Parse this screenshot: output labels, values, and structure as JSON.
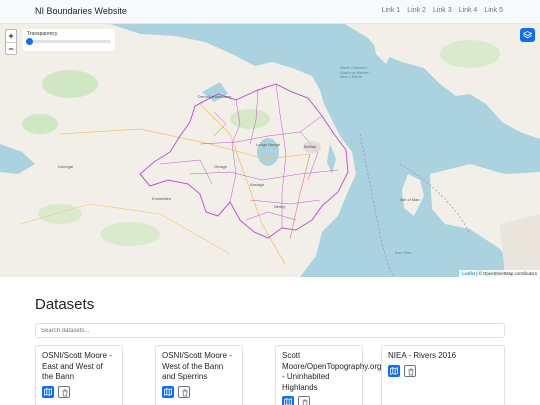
{
  "navbar": {
    "brand": "NI Boundaries Website",
    "links": [
      "Link 1",
      "Link 2",
      "Link 3",
      "Link 4",
      "Link 5"
    ]
  },
  "map": {
    "zoom_in": "+",
    "zoom_out": "−",
    "transparency_label": "Transparency",
    "transparency_value": 0,
    "attribution_leaflet": "Leaflet",
    "attribution_rest": " | © OpenStreetMap contributors",
    "labels": {
      "north_channel": "North Channel / Sruth na Maoile / Sea o Movle",
      "belfast": "Belfast",
      "armagh": "Armagh",
      "isle_of_man": "Isle of Man",
      "derry": "Derry/Londonderry",
      "omagh": "Omagh",
      "lough_neagh": "Lough Neagh",
      "newry": "Newry",
      "enniskillen": "Enniskillen",
      "donegal": "Donegal",
      "irish_sea": "Irish Sea"
    },
    "icons": {
      "layers": "layers-icon"
    }
  },
  "datasets": {
    "title": "Datasets",
    "search_placeholder": "Search datasets...",
    "cards": [
      {
        "title": "OSNI/Scott Moore - East and West of the Bann"
      },
      {
        "title": "OSNI/Scott Moore - West of the Bann and Sperrins"
      },
      {
        "title": "Scott Moore/OpenTopography.org - Uninhabited Highlands"
      },
      {
        "title": "NIEA - Rivers 2016"
      }
    ]
  },
  "colors": {
    "primary": "#0d6efd",
    "sea": "#aad3df",
    "land": "#f2efe9",
    "boundary": "#c356c9"
  }
}
